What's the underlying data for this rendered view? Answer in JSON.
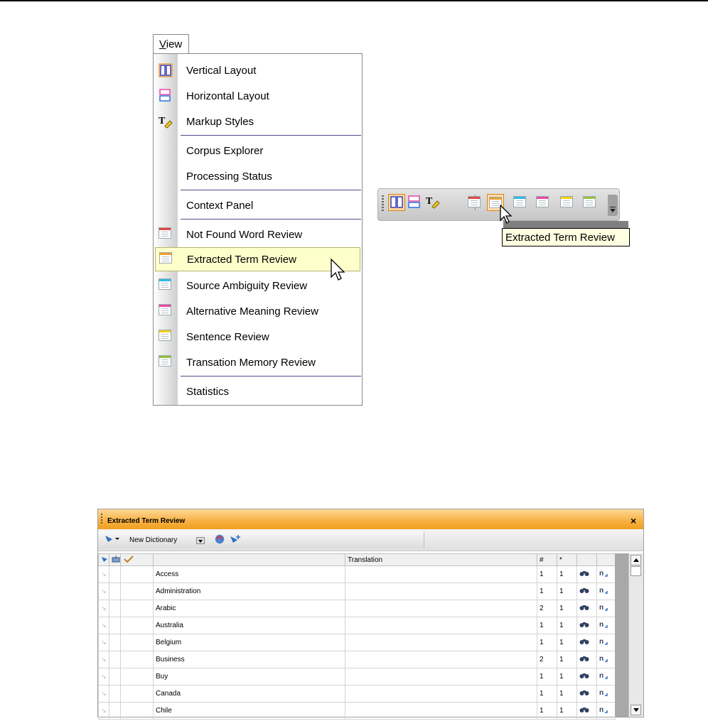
{
  "menu": {
    "title": "View",
    "title_underline": "V",
    "title_rest": "iew",
    "items": [
      {
        "label": "Vertical Layout",
        "icon": "vertical-layout-icon"
      },
      {
        "label": "Horizontal Layout",
        "icon": "horizontal-layout-icon"
      },
      {
        "label": "Markup Styles",
        "icon": "markup-styles-icon"
      },
      {
        "label": "Corpus Explorer",
        "icon": ""
      },
      {
        "label": "Processing Status",
        "icon": ""
      },
      {
        "label": "Context Panel",
        "icon": ""
      },
      {
        "label": "Not Found Word Review",
        "icon": "red-list-icon"
      },
      {
        "label": "Extracted Term Review",
        "icon": "orange-list-icon",
        "highlighted": true
      },
      {
        "label": "Source Ambiguity Review",
        "icon": "cyan-list-icon"
      },
      {
        "label": "Alternative Meaning Review",
        "icon": "pink-list-icon"
      },
      {
        "label": "Sentence Review",
        "icon": "yellow-list-icon"
      },
      {
        "label": "Transation Memory Review",
        "icon": "green-list-icon"
      },
      {
        "label": "Statistics",
        "icon": ""
      }
    ]
  },
  "toolbar": {
    "tooltip": "Extracted Term Review",
    "buttons": [
      "vertical-layout-icon",
      "horizontal-layout-icon",
      "markup-styles-icon",
      "red-list-icon",
      "orange-list-icon",
      "cyan-list-icon",
      "pink-list-icon",
      "yellow-list-icon",
      "green-list-icon"
    ]
  },
  "panel": {
    "title": "Extracted Term Review",
    "close": "×",
    "dictionary": "New Dictionary",
    "columns": {
      "term": "",
      "translation": "Translation",
      "count": "#",
      "star": "*"
    },
    "rows": [
      {
        "term": "Access",
        "count": "1",
        "star": "1"
      },
      {
        "term": "Administration",
        "count": "1",
        "star": "1"
      },
      {
        "term": "Arabic",
        "count": "2",
        "star": "1"
      },
      {
        "term": "Australia",
        "count": "1",
        "star": "1"
      },
      {
        "term": "Belgium",
        "count": "1",
        "star": "1"
      },
      {
        "term": "Business",
        "count": "2",
        "star": "1"
      },
      {
        "term": "Buy",
        "count": "1",
        "star": "1"
      },
      {
        "term": "Canada",
        "count": "1",
        "star": "1"
      },
      {
        "term": "Chile",
        "count": "1",
        "star": "1"
      }
    ]
  },
  "colors": {
    "accent": "#f0a020",
    "highlight": "#ffffcc",
    "tooltip": "#ffffe1"
  }
}
